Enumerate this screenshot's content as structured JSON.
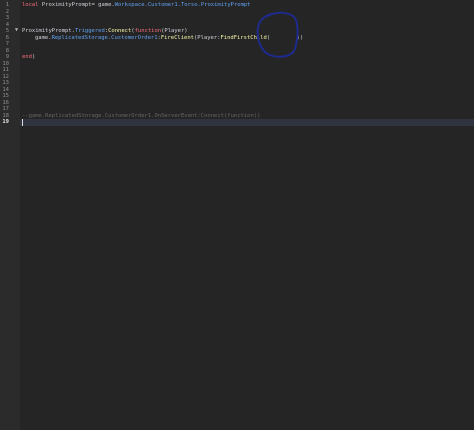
{
  "editor": {
    "line_numbers": [
      "1",
      "2",
      "3",
      "4",
      "5",
      "6",
      "7",
      "8",
      "9",
      "10",
      "11",
      "12",
      "13",
      "14",
      "15",
      "16",
      "17",
      "18",
      "19"
    ],
    "current_line": "19",
    "fold_glyph": "▼",
    "lines": {
      "l1": {
        "keyword": "local",
        "name": " ProximityPrompt",
        "eq": "= ",
        "base": "game.",
        "path": "Workspace.Customer1.Torso.ProximityPrompt"
      },
      "l5": {
        "obj": "ProximityPrompt.",
        "event": "Triggered",
        "colon": ":",
        "method": "Connect",
        "open": "(",
        "kw": "function",
        "args": "(Player)"
      },
      "l6": {
        "base": "game.",
        "path": "ReplicatedStorage.CustomerOrder1",
        "colon1": ":",
        "method1": "FireClient",
        "args_a": "(Player:",
        "method2": "FindFirstChild",
        "args_b": "(        ))"
      },
      "l9": {
        "kw": "end",
        "close": ")"
      },
      "l18": {
        "comment": "--game.ReplicatedStorage.CustomerOrder1.OnServerEvent:Connect(function()"
      }
    }
  },
  "annotation": {
    "stroke_color": "#1e2a8c"
  }
}
